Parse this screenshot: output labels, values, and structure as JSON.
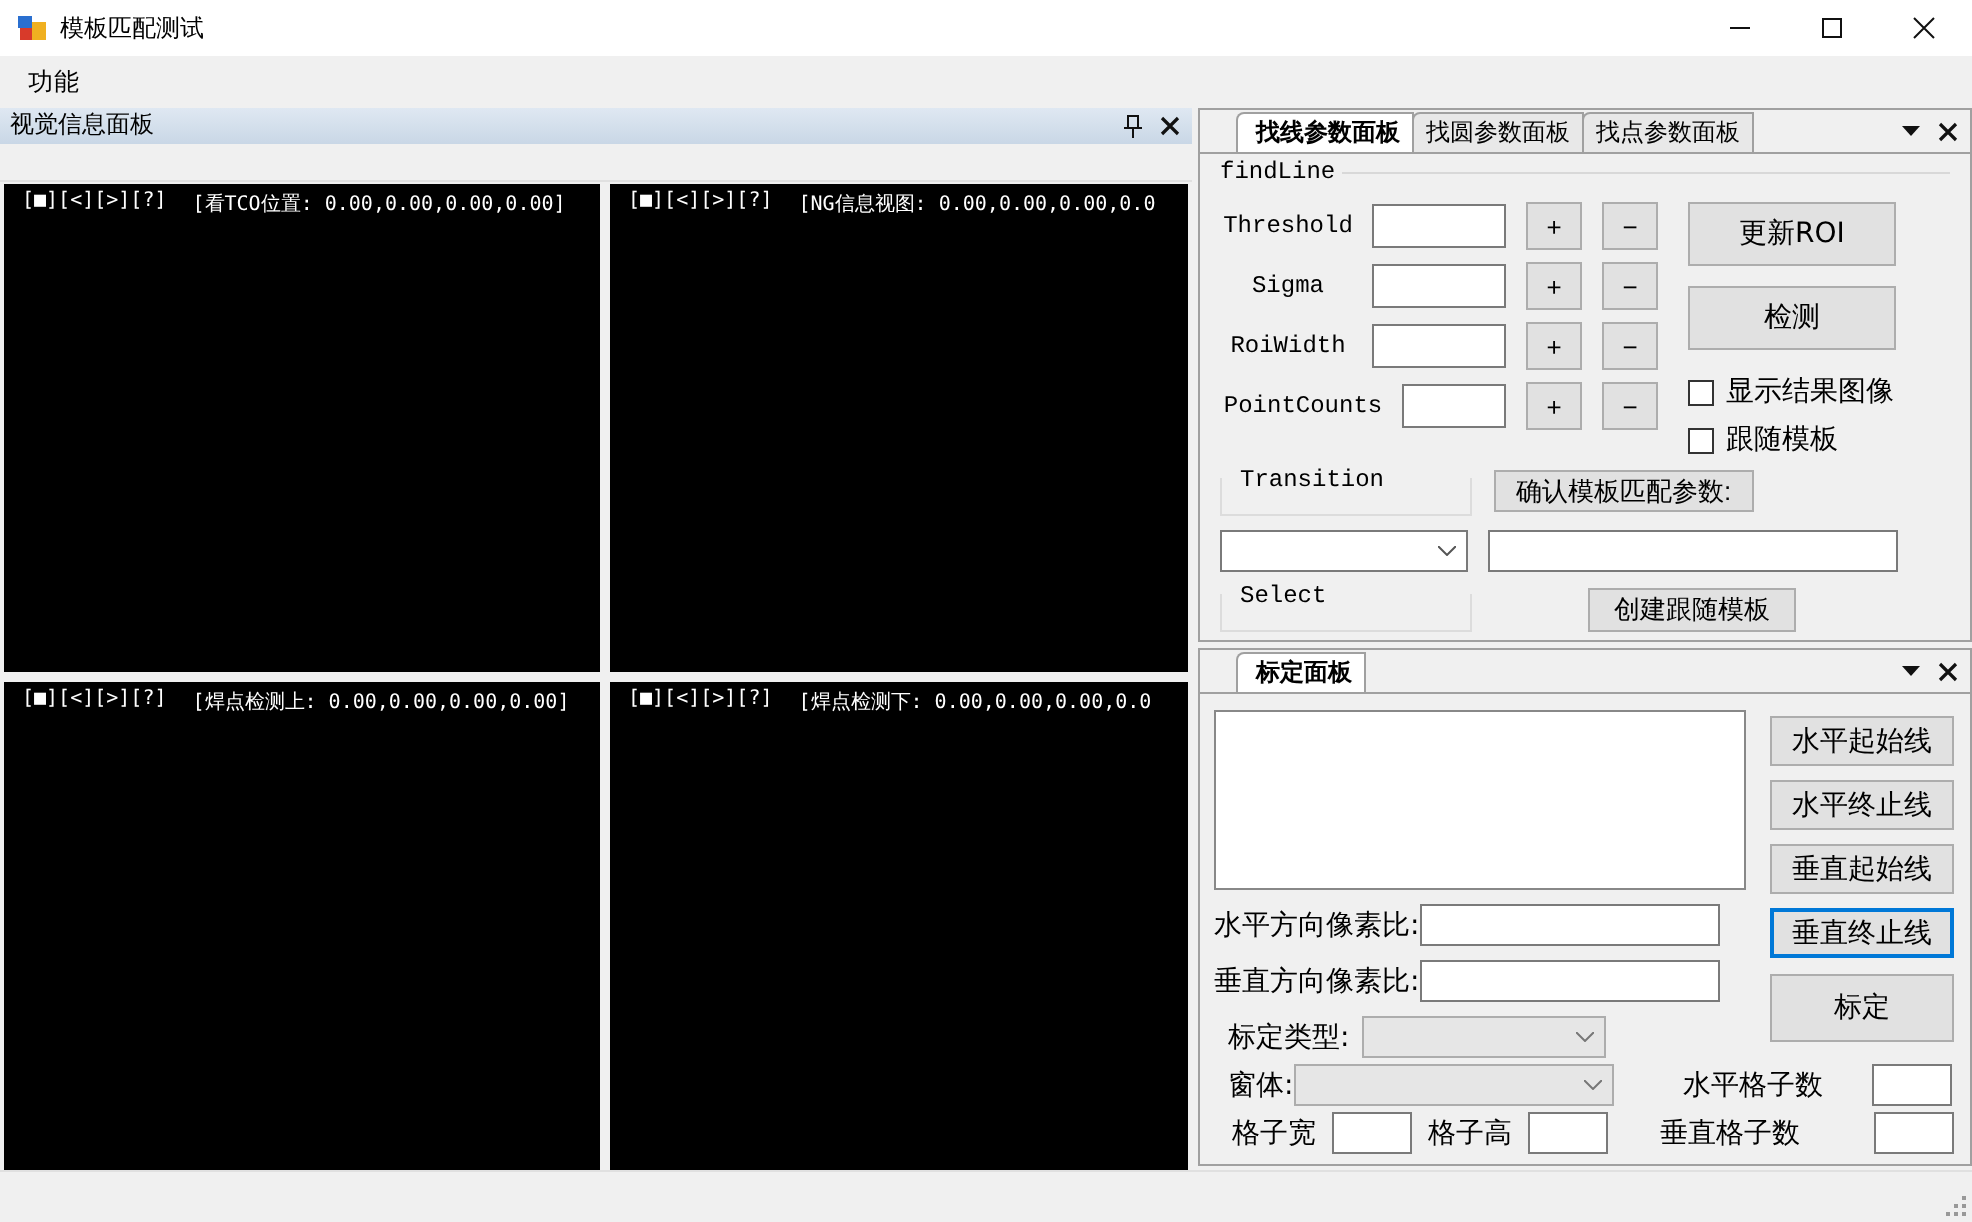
{
  "window": {
    "title": "模板匹配测试"
  },
  "menu": [
    {
      "label": "功能"
    }
  ],
  "vision_panel": {
    "title": "视觉信息面板",
    "viewers": [
      {
        "toolbar": "[■][<][>][?]",
        "caption": "[看TCO位置: 0.00,0.00,0.00,0.00]"
      },
      {
        "toolbar": "[■][<][>][?]",
        "caption": "[NG信息视图: 0.00,0.00,0.00,0.0"
      },
      {
        "toolbar": "[■][<][>][?]",
        "caption": "[焊点检测上: 0.00,0.00,0.00,0.00]"
      },
      {
        "toolbar": "[■][<][>][?]",
        "caption": "[焊点检测下: 0.00,0.00,0.00,0.0"
      }
    ]
  },
  "param_panel": {
    "tabs": [
      {
        "label": "找线参数面板",
        "selected": true
      },
      {
        "label": "找圆参数面板",
        "selected": false
      },
      {
        "label": "找点参数面板",
        "selected": false
      }
    ],
    "group": "findLine",
    "params": [
      {
        "label": "Threshold",
        "plus": "+",
        "minus": "−"
      },
      {
        "label": "Sigma",
        "plus": "+",
        "minus": "−"
      },
      {
        "label": "RoiWidth",
        "plus": "+",
        "minus": "−"
      },
      {
        "label": "PointCounts",
        "plus": "+",
        "minus": "−"
      }
    ],
    "actions": [
      {
        "label": "更新ROI"
      },
      {
        "label": "检测"
      }
    ],
    "checkboxes": [
      {
        "label": "显示结果图像",
        "checked": false
      },
      {
        "label": "跟随模板",
        "checked": false
      }
    ],
    "transition_group": "Transition",
    "confirm_button": "确认模板匹配参数:",
    "select_group": "Select",
    "create_button": "创建跟随模板"
  },
  "calib_panel": {
    "tabs": [
      {
        "label": "标定面板",
        "selected": true
      }
    ],
    "buttons": [
      {
        "label": "水平起始线",
        "focused": false
      },
      {
        "label": "水平终止线",
        "focused": false
      },
      {
        "label": "垂直起始线",
        "focused": false
      },
      {
        "label": "垂直终止线",
        "focused": true
      },
      {
        "label": "标定",
        "focused": false
      }
    ],
    "fields": [
      {
        "label": "水平方向像素比:"
      },
      {
        "label": "垂直方向像素比:"
      }
    ],
    "type_label": "标定类型:",
    "window_label": "窗体:",
    "h_grid_label": "水平格子数",
    "bottom_labels": [
      "格子宽",
      "格子高",
      "垂直格子数"
    ]
  }
}
